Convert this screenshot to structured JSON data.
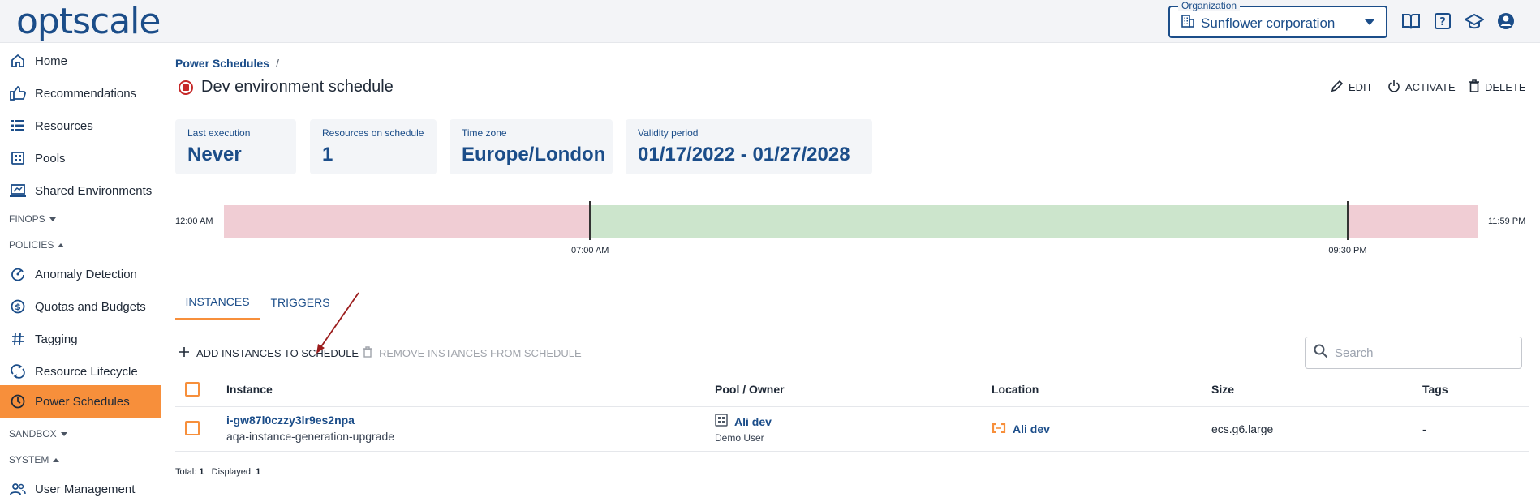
{
  "app": {
    "logo": "optscale"
  },
  "org": {
    "legend": "Organization",
    "value": "Sunflower corporation"
  },
  "sidebar": {
    "items": [
      {
        "label": "Home",
        "icon": "home-icon"
      },
      {
        "label": "Recommendations",
        "icon": "thumbs-up-icon"
      },
      {
        "label": "Resources",
        "icon": "list-icon"
      },
      {
        "label": "Pools",
        "icon": "pools-icon"
      },
      {
        "label": "Shared Environments",
        "icon": "environment-icon"
      }
    ],
    "section_finops": "FINOPS",
    "section_policies": "POLICIES",
    "policies_items": [
      {
        "label": "Anomaly Detection",
        "icon": "anomaly-icon"
      },
      {
        "label": "Quotas and Budgets",
        "icon": "quota-icon"
      },
      {
        "label": "Tagging",
        "icon": "hash-icon"
      },
      {
        "label": "Resource Lifecycle",
        "icon": "lifecycle-icon"
      },
      {
        "label": "Power Schedules",
        "icon": "clock-icon"
      }
    ],
    "section_sandbox": "SANDBOX",
    "section_system": "SYSTEM",
    "system_items": [
      {
        "label": "User Management",
        "icon": "users-icon"
      }
    ]
  },
  "breadcrumb": {
    "parent": "Power Schedules",
    "sep": "/"
  },
  "page": {
    "title": "Dev environment schedule"
  },
  "actions": {
    "edit": "EDIT",
    "activate": "ACTIVATE",
    "delete": "DELETE"
  },
  "cards": [
    {
      "label": "Last execution",
      "value": "Never"
    },
    {
      "label": "Resources on schedule",
      "value": "1"
    },
    {
      "label": "Time zone",
      "value": "Europe/London"
    },
    {
      "label": "Validity period",
      "value": "01/17/2022 - 01/27/2028"
    }
  ],
  "timeline": {
    "start": "12:00 AM",
    "end": "11:59 PM",
    "on_time": "07:00 AM",
    "off_time": "09:30 PM",
    "on_fraction": 0.2917,
    "off_fraction": 0.8958,
    "colors": {
      "off": "#f0cdd4",
      "on": "#cce5cc"
    }
  },
  "tabs": [
    {
      "label": "INSTANCES"
    },
    {
      "label": "TRIGGERS"
    }
  ],
  "toolbar": {
    "add": "ADD INSTANCES TO SCHEDULE",
    "remove": "REMOVE INSTANCES FROM SCHEDULE",
    "search_placeholder": "Search"
  },
  "table": {
    "headers": [
      "Instance",
      "Pool / Owner",
      "Location",
      "Size",
      "Tags"
    ],
    "rows": [
      {
        "instance": "i-gw87l0czzy3lr9es2npa",
        "instance_name": "aqa-instance-generation-upgrade",
        "pool": "Ali dev",
        "owner": "Demo User",
        "location": "Ali dev",
        "size": "ecs.g6.large",
        "tags": "-"
      }
    ]
  },
  "footer": {
    "total_label": "Total:",
    "total": "1",
    "displayed_label": "Displayed:",
    "displayed": "1"
  },
  "colors": {
    "brand": "#1b4d89",
    "accent": "#f78f3b",
    "danger": "#c62828"
  }
}
